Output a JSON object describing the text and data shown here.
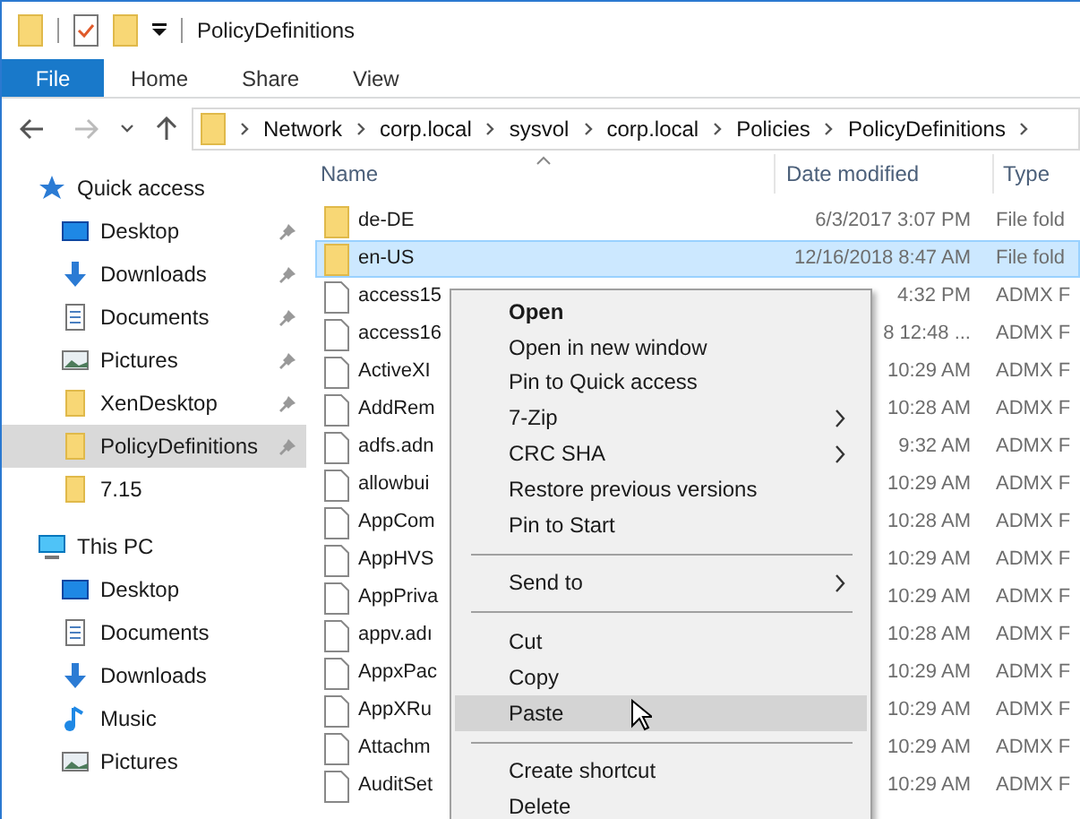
{
  "window": {
    "title": "PolicyDefinitions"
  },
  "ribbon_tabs": [
    {
      "label": "File",
      "kind": "file"
    },
    {
      "label": "Home",
      "kind": "tab"
    },
    {
      "label": "Share",
      "kind": "tab"
    },
    {
      "label": "View",
      "kind": "tab"
    }
  ],
  "address_bar": {
    "crumbs": [
      "Network",
      "corp.local",
      "sysvol",
      "corp.local",
      "Policies",
      "PolicyDefinitions"
    ]
  },
  "columns": [
    "Name",
    "Date modified",
    "Type"
  ],
  "sidebar": {
    "items": [
      {
        "label": "Quick access",
        "kind": "star",
        "pinned": false,
        "selected": false,
        "group": true
      },
      {
        "label": "Desktop",
        "kind": "desktop",
        "pinned": true,
        "selected": false,
        "group": false
      },
      {
        "label": "Downloads",
        "kind": "downloads",
        "pinned": true,
        "selected": false,
        "group": false
      },
      {
        "label": "Documents",
        "kind": "documents",
        "pinned": true,
        "selected": false,
        "group": false
      },
      {
        "label": "Pictures",
        "kind": "pictures",
        "pinned": true,
        "selected": false,
        "group": false
      },
      {
        "label": "XenDesktop",
        "kind": "folder",
        "pinned": true,
        "selected": false,
        "group": false
      },
      {
        "label": "PolicyDefinitions",
        "kind": "folder",
        "pinned": true,
        "selected": true,
        "group": false
      },
      {
        "label": "7.15",
        "kind": "folder",
        "pinned": false,
        "selected": false,
        "group": false
      },
      {
        "label": "This PC",
        "kind": "pc",
        "pinned": false,
        "selected": false,
        "group": true
      },
      {
        "label": "Desktop",
        "kind": "desktop",
        "pinned": false,
        "selected": false,
        "group": false
      },
      {
        "label": "Documents",
        "kind": "documents",
        "pinned": false,
        "selected": false,
        "group": false
      },
      {
        "label": "Downloads",
        "kind": "downloads",
        "pinned": false,
        "selected": false,
        "group": false
      },
      {
        "label": "Music",
        "kind": "music",
        "pinned": false,
        "selected": false,
        "group": false
      },
      {
        "label": "Pictures",
        "kind": "pictures",
        "pinned": false,
        "selected": false,
        "group": false
      }
    ]
  },
  "files": [
    {
      "name": "de-DE",
      "date": "6/3/2017 3:07 PM",
      "type": "File fold",
      "kind": "folder",
      "selected": false
    },
    {
      "name": "en-US",
      "date": "12/16/2018 8:47 AM",
      "type": "File fold",
      "kind": "folder",
      "selected": true
    },
    {
      "name": "access15",
      "date": "4:32 PM",
      "type": "ADMX F",
      "kind": "file",
      "selected": false
    },
    {
      "name": "access16",
      "date": "8 12:48 ...",
      "type": "ADMX F",
      "kind": "file",
      "selected": false
    },
    {
      "name": "ActiveXI",
      "date": "10:29 AM",
      "type": "ADMX F",
      "kind": "file",
      "selected": false
    },
    {
      "name": "AddRem",
      "date": "10:28 AM",
      "type": "ADMX F",
      "kind": "file",
      "selected": false
    },
    {
      "name": "adfs.adn",
      "date": "9:32 AM",
      "type": "ADMX F",
      "kind": "file",
      "selected": false
    },
    {
      "name": "allowbui",
      "date": "10:29 AM",
      "type": "ADMX F",
      "kind": "file",
      "selected": false
    },
    {
      "name": "AppCom",
      "date": "10:28 AM",
      "type": "ADMX F",
      "kind": "file",
      "selected": false
    },
    {
      "name": "AppHVS",
      "date": "10:29 AM",
      "type": "ADMX F",
      "kind": "file",
      "selected": false
    },
    {
      "name": "AppPriva",
      "date": "10:29 AM",
      "type": "ADMX F",
      "kind": "file",
      "selected": false
    },
    {
      "name": "appv.adı",
      "date": "10:28 AM",
      "type": "ADMX F",
      "kind": "file",
      "selected": false
    },
    {
      "name": "AppxPac",
      "date": "10:29 AM",
      "type": "ADMX F",
      "kind": "file",
      "selected": false
    },
    {
      "name": "AppXRu",
      "date": "10:29 AM",
      "type": "ADMX F",
      "kind": "file",
      "selected": false
    },
    {
      "name": "Attachm",
      "date": "10:29 AM",
      "type": "ADMX F",
      "kind": "file",
      "selected": false
    },
    {
      "name": "AuditSet",
      "date": "10:29 AM",
      "type": "ADMX F",
      "kind": "file",
      "selected": false
    }
  ],
  "context_menu": {
    "items": [
      {
        "kind": "item",
        "label": "Open",
        "default": true,
        "submenu": false,
        "selected": false
      },
      {
        "kind": "item",
        "label": "Open in new window",
        "default": false,
        "submenu": false,
        "selected": false
      },
      {
        "kind": "item",
        "label": "Pin to Quick access",
        "default": false,
        "submenu": false,
        "selected": false
      },
      {
        "kind": "item",
        "label": "7-Zip",
        "default": false,
        "submenu": true,
        "selected": false
      },
      {
        "kind": "item",
        "label": "CRC SHA",
        "default": false,
        "submenu": true,
        "selected": false
      },
      {
        "kind": "item",
        "label": "Restore previous versions",
        "default": false,
        "submenu": false,
        "selected": false
      },
      {
        "kind": "item",
        "label": "Pin to Start",
        "default": false,
        "submenu": false,
        "selected": false
      },
      {
        "kind": "separator"
      },
      {
        "kind": "item",
        "label": "Send to",
        "default": false,
        "submenu": true,
        "selected": false
      },
      {
        "kind": "separator"
      },
      {
        "kind": "item",
        "label": "Cut",
        "default": false,
        "submenu": false,
        "selected": false
      },
      {
        "kind": "item",
        "label": "Copy",
        "default": false,
        "submenu": false,
        "selected": false
      },
      {
        "kind": "item",
        "label": "Paste",
        "default": false,
        "submenu": false,
        "selected": true
      },
      {
        "kind": "separator"
      },
      {
        "kind": "item",
        "label": "Create shortcut",
        "default": false,
        "submenu": false,
        "selected": false
      },
      {
        "kind": "item",
        "label": "Delete",
        "default": false,
        "submenu": false,
        "selected": false
      }
    ]
  }
}
